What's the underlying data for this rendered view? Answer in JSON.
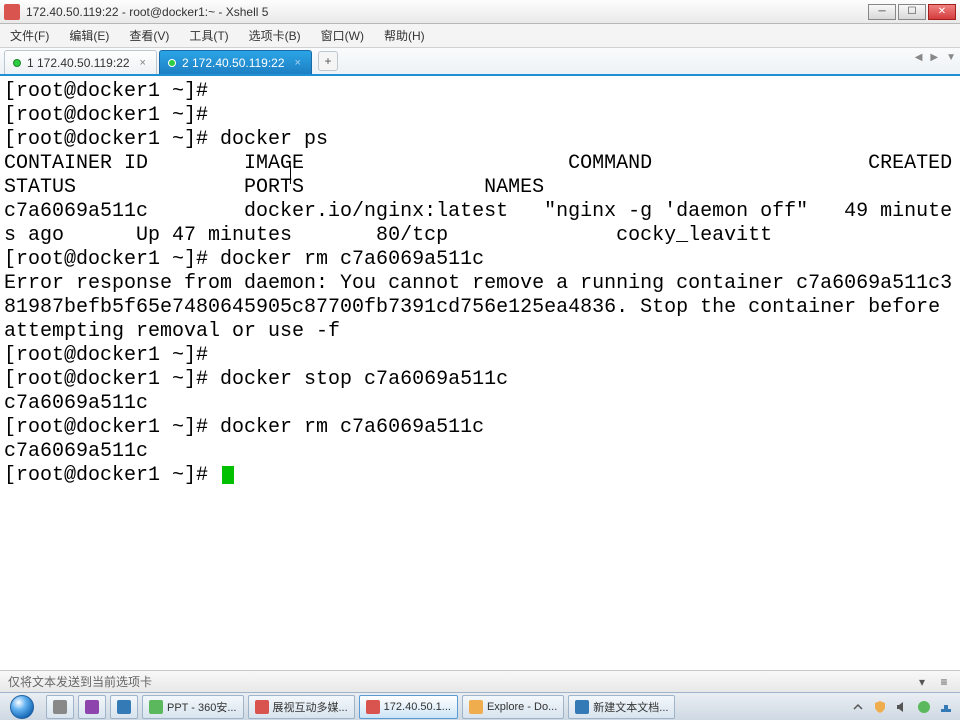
{
  "window": {
    "title": "172.40.50.119:22 - root@docker1:~ - Xshell 5"
  },
  "menu": {
    "file": "文件(F)",
    "edit": "编辑(E)",
    "view": "查看(V)",
    "tools": "工具(T)",
    "tab": "选项卡(B)",
    "window": "窗口(W)",
    "help": "帮助(H)"
  },
  "tabs": {
    "t1": "1 172.40.50.119:22",
    "t2": "2 172.40.50.119:22"
  },
  "terminal": {
    "content": "[root@docker1 ~]# \n[root@docker1 ~]# \n[root@docker1 ~]# docker ps\nCONTAINER ID        IMAGE                      COMMAND                  CREATED             STATUS              PORTS               NAMES\nc7a6069a511c        docker.io/nginx:latest   \"nginx -g 'daemon off\"   49 minutes ago      Up 47 minutes       80/tcp              cocky_leavitt\n[root@docker1 ~]# docker rm c7a6069a511c\nError response from daemon: You cannot remove a running container c7a6069a511c381987befb5f65e7480645905c87700fb7391cd756e125ea4836. Stop the container before attempting removal or use -f\n[root@docker1 ~]# \n[root@docker1 ~]# docker stop c7a6069a511c\nc7a6069a511c\n[root@docker1 ~]# docker rm c7a6069a511c\nc7a6069a511c\n[root@docker1 ~]# "
  },
  "statusbar": {
    "text": "仅将文本发送到当前选项卡"
  },
  "taskbar": {
    "items": [
      "",
      "",
      "",
      "PPT - 360安...",
      "展视互动多媒...",
      "172.40.50.1...",
      "Explore - Do...",
      "新建文本文档..."
    ]
  }
}
